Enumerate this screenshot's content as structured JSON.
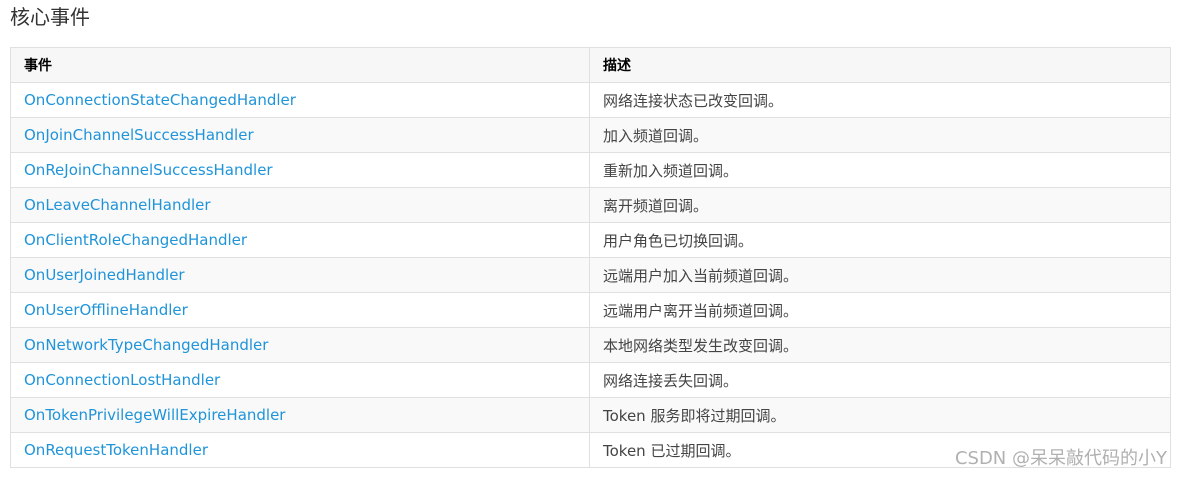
{
  "heading": "核心事件",
  "table": {
    "headers": [
      "事件",
      "描述"
    ],
    "rows": [
      {
        "event": "OnConnectionStateChangedHandler",
        "desc": "网络连接状态已改变回调。"
      },
      {
        "event": "OnJoinChannelSuccessHandler",
        "desc": "加入频道回调。"
      },
      {
        "event": "OnReJoinChannelSuccessHandler",
        "desc": "重新加入频道回调。"
      },
      {
        "event": "OnLeaveChannelHandler",
        "desc": "离开频道回调。"
      },
      {
        "event": "OnClientRoleChangedHandler",
        "desc": "用户角色已切换回调。"
      },
      {
        "event": "OnUserJoinedHandler",
        "desc": "远端用户加入当前频道回调。"
      },
      {
        "event": "OnUserOfflineHandler",
        "desc": "远端用户离开当前频道回调。"
      },
      {
        "event": "OnNetworkTypeChangedHandler",
        "desc": "本地网络类型发生改变回调。"
      },
      {
        "event": "OnConnectionLostHandler",
        "desc": "网络连接丢失回调。"
      },
      {
        "event": "OnTokenPrivilegeWillExpireHandler",
        "desc": "Token 服务即将过期回调。"
      },
      {
        "event": "OnRequestTokenHandler",
        "desc": "Token 已过期回调。"
      }
    ]
  },
  "watermark": "CSDN @呆呆敲代码的小Y",
  "colors": {
    "link": "#1f94d9",
    "header_bg": "#f7f7f7",
    "stripe_bg": "#f9f9f9",
    "border": "#e0e0e0"
  }
}
